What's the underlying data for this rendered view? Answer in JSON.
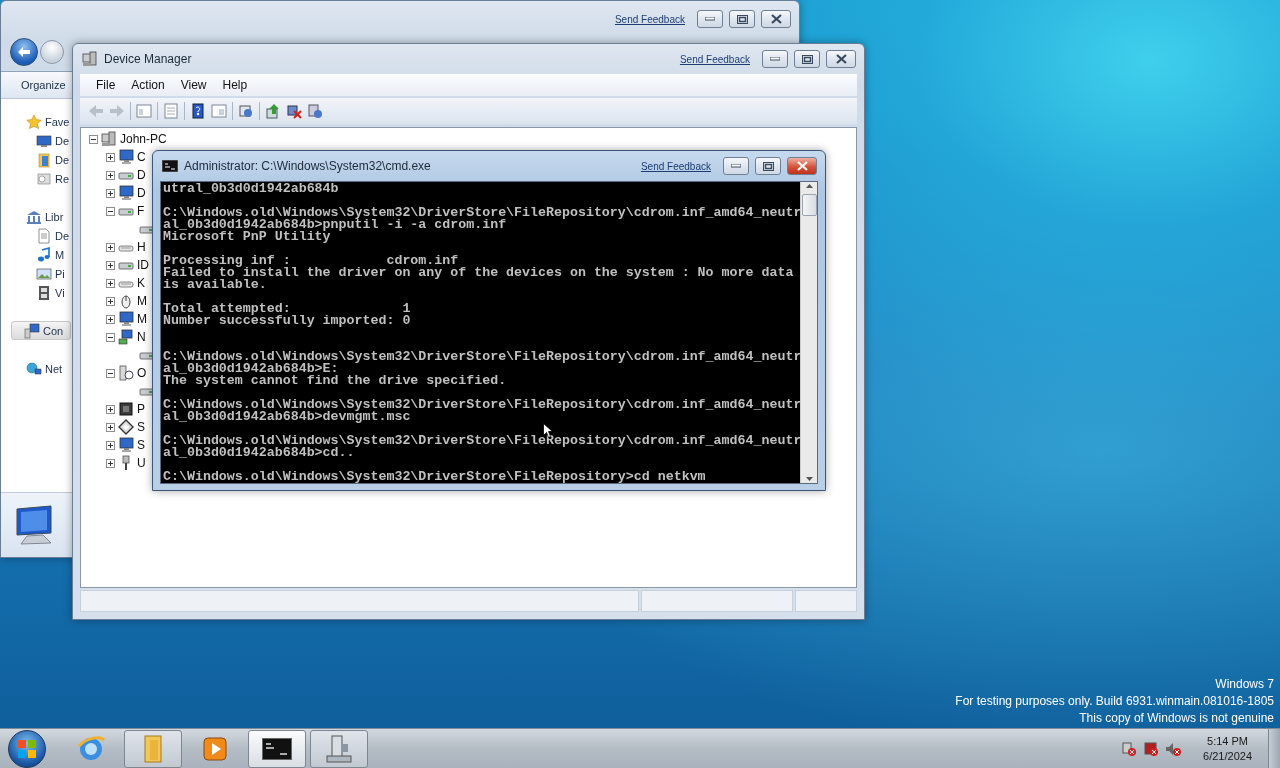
{
  "explorer": {
    "feedback": "Send Feedback",
    "active": false,
    "toolbar": {
      "organize": "Organize"
    },
    "sidebar": [
      {
        "label": "Fave",
        "selected": false,
        "items": [
          {
            "label": "De",
            "selected": false
          },
          {
            "label": "De",
            "selected": false
          },
          {
            "label": "Re",
            "selected": false
          }
        ]
      },
      {
        "label": "Libr",
        "selected": false,
        "items": [
          {
            "label": "De",
            "selected": false
          },
          {
            "label": "M",
            "selected": false
          },
          {
            "label": "Pi",
            "selected": false
          },
          {
            "label": "Vi",
            "selected": false
          }
        ]
      },
      {
        "label": "Con",
        "selected": true
      },
      {
        "label": "Net",
        "selected": false
      }
    ]
  },
  "device_manager": {
    "title": "Device Manager",
    "feedback": "Send Feedback",
    "active": false,
    "menu": [
      "File",
      "Action",
      "View",
      "Help"
    ],
    "tree": {
      "label": "John-PC",
      "expanded": true,
      "children": [
        {
          "label": "C",
          "expanded": false
        },
        {
          "label": "D",
          "expanded": false
        },
        {
          "label": "D",
          "expanded": false
        },
        {
          "label": "F",
          "expanded": true,
          "children": [
            {
              "kind": "device"
            }
          ]
        },
        {
          "label": "H",
          "expanded": false
        },
        {
          "label": "ID",
          "expanded": false
        },
        {
          "label": "K",
          "expanded": false
        },
        {
          "label": "M",
          "expanded": false
        },
        {
          "label": "M",
          "expanded": false
        },
        {
          "label": "N",
          "expanded": true,
          "children": [
            {
              "kind": "device"
            }
          ]
        },
        {
          "label": "O",
          "expanded": true,
          "children": [
            {
              "kind": "device"
            }
          ]
        },
        {
          "label": "P",
          "expanded": false
        },
        {
          "label": "S",
          "expanded": false
        },
        {
          "label": "S",
          "expanded": false
        },
        {
          "label": "U",
          "expanded": false
        }
      ]
    }
  },
  "cmd": {
    "title": "Administrator: C:\\Windows\\System32\\cmd.exe",
    "feedback": "Send Feedback",
    "active": true,
    "lines": [
      {
        "kind": "text",
        "text": "utral_0b3d0d1942ab684b"
      },
      {
        "kind": "blank"
      },
      {
        "kind": "text",
        "text": "C:\\Windows.old\\Windows\\System32\\DriverStore\\FileRepository\\cdrom.inf_amd64_neutr"
      },
      {
        "kind": "text",
        "text": "al_0b3d0d1942ab684b>pnputil -i -a cdrom.inf"
      },
      {
        "kind": "text",
        "text": "Microsoft PnP Utility"
      },
      {
        "kind": "blank"
      },
      {
        "kind": "text",
        "text": "Processing inf :            cdrom.inf"
      },
      {
        "kind": "text",
        "text": "Failed to install the driver on any of the devices on the system : No more data"
      },
      {
        "kind": "text",
        "text": "is available."
      },
      {
        "kind": "blank"
      },
      {
        "kind": "text",
        "text": "Total attempted:              1"
      },
      {
        "kind": "text",
        "text": "Number successfully imported: 0"
      },
      {
        "kind": "blank"
      },
      {
        "kind": "blank"
      },
      {
        "kind": "text",
        "text": "C:\\Windows.old\\Windows\\System32\\DriverStore\\FileRepository\\cdrom.inf_amd64_neutr"
      },
      {
        "kind": "text",
        "text": "al_0b3d0d1942ab684b>E:"
      },
      {
        "kind": "text",
        "text": "The system cannot find the drive specified."
      },
      {
        "kind": "blank"
      },
      {
        "kind": "text",
        "text": "C:\\Windows.old\\Windows\\System32\\DriverStore\\FileRepository\\cdrom.inf_amd64_neutr"
      },
      {
        "kind": "text",
        "text": "al_0b3d0d1942ab684b>devmgmt.msc"
      },
      {
        "kind": "blank"
      },
      {
        "kind": "text",
        "text": "C:\\Windows.old\\Windows\\System32\\DriverStore\\FileRepository\\cdrom.inf_amd64_neutr"
      },
      {
        "kind": "text",
        "text": "al_0b3d0d1942ab684b>cd.."
      },
      {
        "kind": "blank"
      },
      {
        "kind": "text",
        "text": "C:\\Windows.old\\Windows\\System32\\DriverStore\\FileRepository>cd netkvm"
      }
    ]
  },
  "desktop": {
    "notice": [
      "Windows 7",
      "For testing purposes only. Build 6931.winmain.081016-1805",
      "This copy of Windows is not genuine"
    ]
  },
  "taskbar": {
    "items": [
      {
        "kind": "browser",
        "running": false,
        "selected": false
      },
      {
        "kind": "explorer",
        "running": true,
        "selected": false
      },
      {
        "kind": "media",
        "running": false,
        "selected": false
      },
      {
        "kind": "console",
        "running": true,
        "selected": true
      },
      {
        "kind": "devices",
        "running": true,
        "selected": false
      }
    ],
    "clock": {
      "time": "5:14 PM",
      "date": "6/21/2024"
    }
  }
}
